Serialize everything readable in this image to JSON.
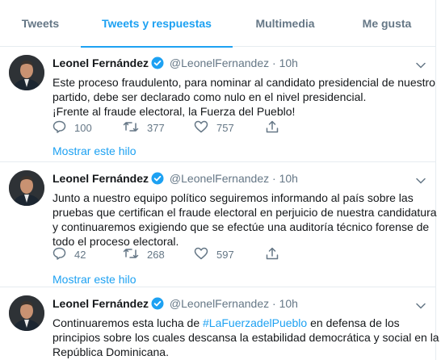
{
  "tabs": [
    {
      "label": "Tweets",
      "active": false
    },
    {
      "label": "Tweets y respuestas",
      "active": true
    },
    {
      "label": "Multimedia",
      "active": false
    },
    {
      "label": "Me gusta",
      "active": false
    }
  ],
  "tweets": [
    {
      "name": "Leonel Fernández",
      "handle": "@LeonelFernandez",
      "separator": "·",
      "time": "10h",
      "lines": [
        "Este proceso fraudulento, para nominar al candidato presidencial de nuestro",
        "partido, debe ser declarado como nulo en el nivel presidencial.",
        "¡Frente al fraude electoral, la Fuerza del Pueblo!"
      ],
      "replies": "100",
      "retweets": "377",
      "likes": "757",
      "thread_link": "Mostrar este hilo"
    },
    {
      "name": "Leonel Fernández",
      "handle": "@LeonelFernandez",
      "separator": "·",
      "time": "10h",
      "lines": [
        "Junto a nuestro equipo político seguiremos informando al país sobre las",
        "pruebas que certifican el fraude electoral en perjuicio de nuestra candidatura",
        "y continuaremos exigiendo que se efectúe una auditoría técnico forense de",
        "todo el proceso electoral."
      ],
      "replies": "42",
      "retweets": "268",
      "likes": "597",
      "thread_link": "Mostrar este hilo"
    },
    {
      "name": "Leonel Fernández",
      "handle": "@LeonelFernandez",
      "separator": "·",
      "time": "10h",
      "line1_pre": "Continuaremos esta lucha de ",
      "hashtag": "#LaFuerzadelPueblo",
      "line1_post": " en defensa de los",
      "lines": [
        "principios sobre los cuales descansa la estabilidad democrática y social en la",
        "República Dominicana."
      ]
    }
  ],
  "colors": {
    "accent": "#1da1f2",
    "secondary_text": "#657786",
    "border": "#e6ecf0",
    "verified": "#1da1f2"
  },
  "icons": {
    "reply": "reply-icon",
    "retweet": "retweet-icon",
    "like": "heart-icon",
    "share": "share-icon",
    "verified": "verified-badge-icon",
    "menu": "chevron-down-icon"
  }
}
